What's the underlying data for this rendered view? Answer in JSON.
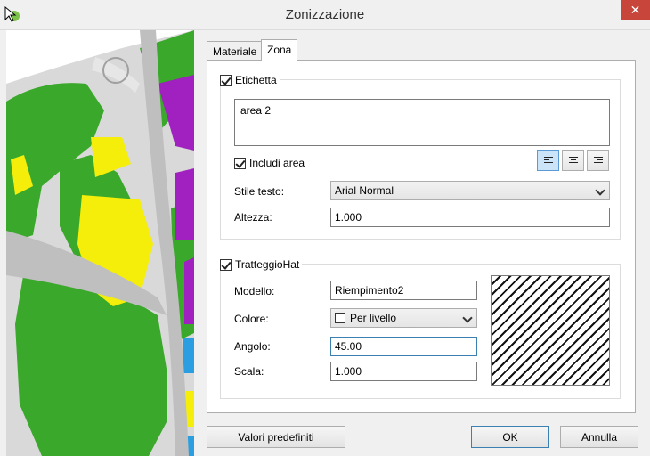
{
  "window": {
    "title": "Zonizzazione",
    "close_glyph": "✕"
  },
  "tabs": [
    {
      "label": "Materiale"
    },
    {
      "label": "Zona"
    }
  ],
  "etichetta": {
    "legend": "Etichetta",
    "checked": true,
    "text": "area 2",
    "includi_area_label": "Includi area",
    "includi_area_checked": true,
    "align_buttons": [
      "align-left-icon",
      "align-center-icon",
      "align-right-icon"
    ],
    "stile_testo_label": "Stile testo:",
    "stile_testo_value": "Arial Normal",
    "altezza_label": "Altezza:",
    "altezza_value": "1.000"
  },
  "tratteggio": {
    "legend": "TratteggioHat",
    "checked": true,
    "modello_label": "Modello:",
    "modello_value": "Riempimento2",
    "colore_label": "Colore:",
    "colore_value": "Per livello",
    "angolo_label": "Angolo:",
    "angolo_value": "45.00",
    "scala_label": "Scala:",
    "scala_value": "1.000"
  },
  "buttons": {
    "defaults": "Valori predefiniti",
    "ok": "OK",
    "cancel": "Annulla"
  },
  "colors": {
    "close_red": "#c7453a",
    "map_green": "#3aa82a",
    "map_yellow": "#f5ee0a",
    "map_purple": "#a020c0",
    "map_blue": "#2a9ee0",
    "road_gray": "#bfbfbf",
    "selected_align": "#cce4f7"
  }
}
